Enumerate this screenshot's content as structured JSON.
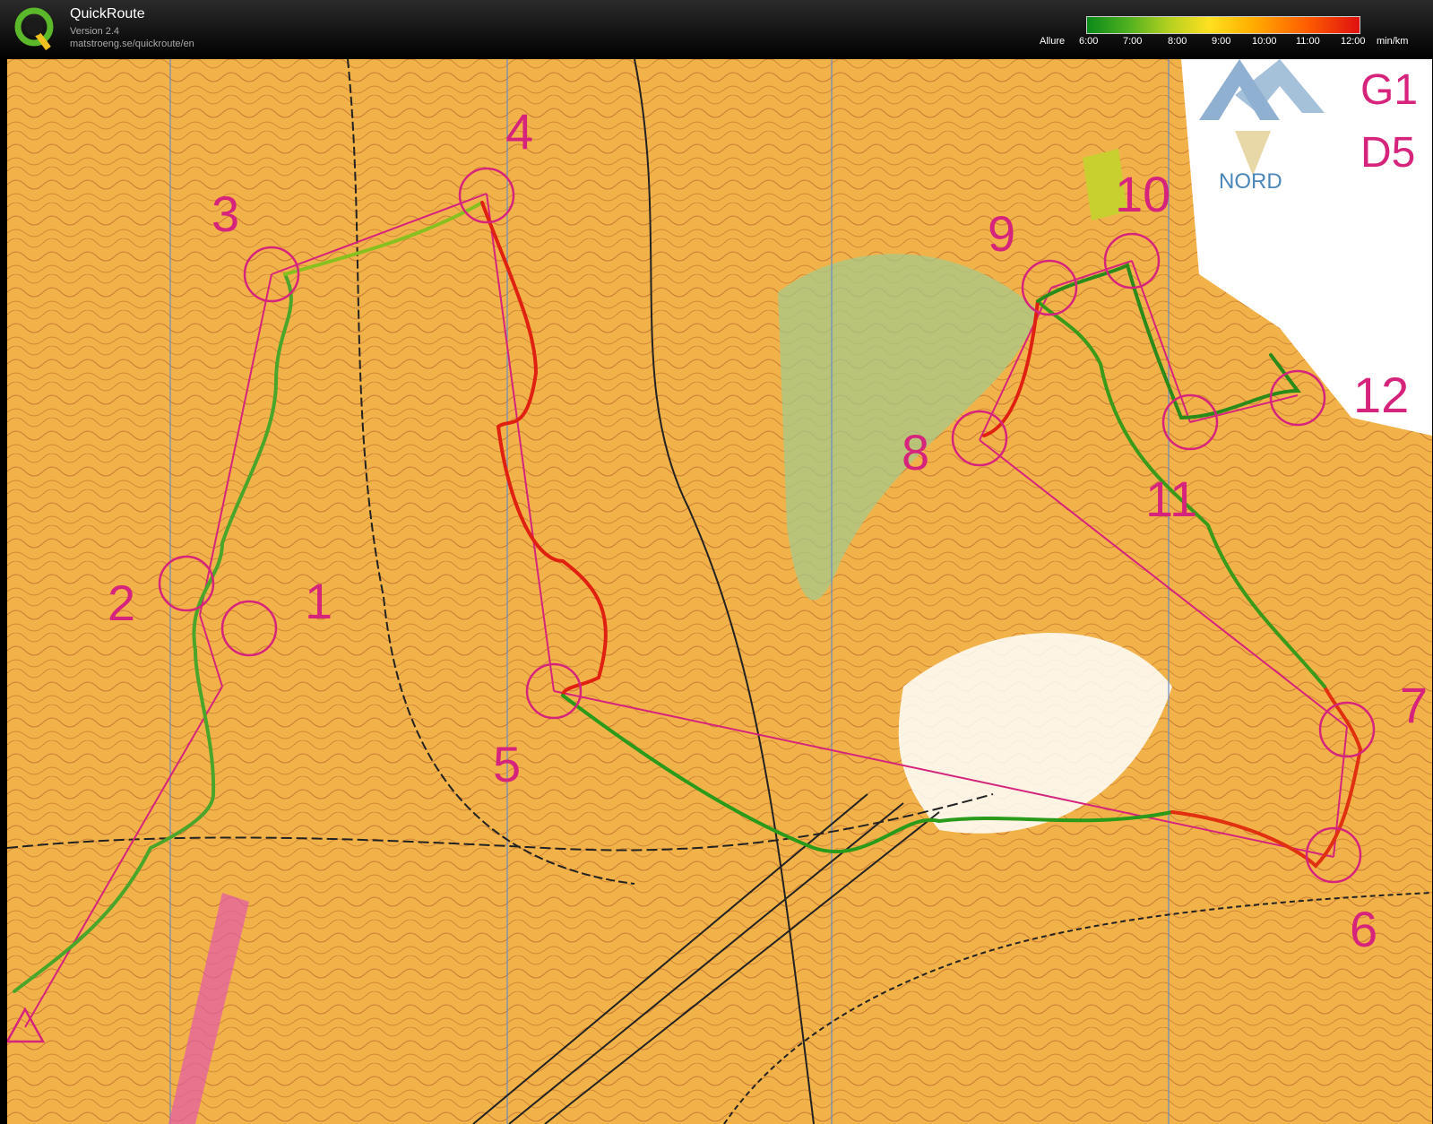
{
  "app": {
    "title": "QuickRoute",
    "version": "Version 2.4",
    "url": "matstroeng.se/quickroute/en",
    "logo_letter": "Q"
  },
  "legend": {
    "label": "Allure",
    "unit": "min/km",
    "ticks": [
      "6:00",
      "7:00",
      "8:00",
      "9:00",
      "10:00",
      "11:00",
      "12:00"
    ],
    "colors": {
      "fast": "#0a8a1a",
      "mid": "#ffe020",
      "slow": "#e01010"
    }
  },
  "map": {
    "north_label": "NORD",
    "corner_text_1": "G1",
    "corner_text_2": "D5",
    "controls": [
      "1",
      "2",
      "3",
      "4",
      "5",
      "6",
      "7",
      "8",
      "9",
      "10",
      "11",
      "12"
    ],
    "course_color": "#d6247c",
    "background_color": "#f2b24a"
  }
}
